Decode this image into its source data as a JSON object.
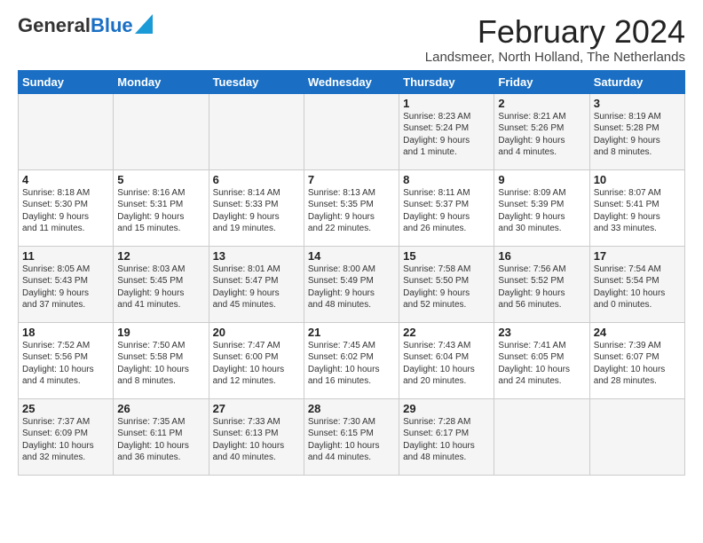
{
  "header": {
    "logo_general": "General",
    "logo_blue": "Blue",
    "month_title": "February 2024",
    "location": "Landsmeer, North Holland, The Netherlands"
  },
  "weekdays": [
    "Sunday",
    "Monday",
    "Tuesday",
    "Wednesday",
    "Thursday",
    "Friday",
    "Saturday"
  ],
  "rows": [
    [
      {
        "day": "",
        "info": ""
      },
      {
        "day": "",
        "info": ""
      },
      {
        "day": "",
        "info": ""
      },
      {
        "day": "",
        "info": ""
      },
      {
        "day": "1",
        "info": "Sunrise: 8:23 AM\nSunset: 5:24 PM\nDaylight: 9 hours\nand 1 minute."
      },
      {
        "day": "2",
        "info": "Sunrise: 8:21 AM\nSunset: 5:26 PM\nDaylight: 9 hours\nand 4 minutes."
      },
      {
        "day": "3",
        "info": "Sunrise: 8:19 AM\nSunset: 5:28 PM\nDaylight: 9 hours\nand 8 minutes."
      }
    ],
    [
      {
        "day": "4",
        "info": "Sunrise: 8:18 AM\nSunset: 5:30 PM\nDaylight: 9 hours\nand 11 minutes."
      },
      {
        "day": "5",
        "info": "Sunrise: 8:16 AM\nSunset: 5:31 PM\nDaylight: 9 hours\nand 15 minutes."
      },
      {
        "day": "6",
        "info": "Sunrise: 8:14 AM\nSunset: 5:33 PM\nDaylight: 9 hours\nand 19 minutes."
      },
      {
        "day": "7",
        "info": "Sunrise: 8:13 AM\nSunset: 5:35 PM\nDaylight: 9 hours\nand 22 minutes."
      },
      {
        "day": "8",
        "info": "Sunrise: 8:11 AM\nSunset: 5:37 PM\nDaylight: 9 hours\nand 26 minutes."
      },
      {
        "day": "9",
        "info": "Sunrise: 8:09 AM\nSunset: 5:39 PM\nDaylight: 9 hours\nand 30 minutes."
      },
      {
        "day": "10",
        "info": "Sunrise: 8:07 AM\nSunset: 5:41 PM\nDaylight: 9 hours\nand 33 minutes."
      }
    ],
    [
      {
        "day": "11",
        "info": "Sunrise: 8:05 AM\nSunset: 5:43 PM\nDaylight: 9 hours\nand 37 minutes."
      },
      {
        "day": "12",
        "info": "Sunrise: 8:03 AM\nSunset: 5:45 PM\nDaylight: 9 hours\nand 41 minutes."
      },
      {
        "day": "13",
        "info": "Sunrise: 8:01 AM\nSunset: 5:47 PM\nDaylight: 9 hours\nand 45 minutes."
      },
      {
        "day": "14",
        "info": "Sunrise: 8:00 AM\nSunset: 5:49 PM\nDaylight: 9 hours\nand 48 minutes."
      },
      {
        "day": "15",
        "info": "Sunrise: 7:58 AM\nSunset: 5:50 PM\nDaylight: 9 hours\nand 52 minutes."
      },
      {
        "day": "16",
        "info": "Sunrise: 7:56 AM\nSunset: 5:52 PM\nDaylight: 9 hours\nand 56 minutes."
      },
      {
        "day": "17",
        "info": "Sunrise: 7:54 AM\nSunset: 5:54 PM\nDaylight: 10 hours\nand 0 minutes."
      }
    ],
    [
      {
        "day": "18",
        "info": "Sunrise: 7:52 AM\nSunset: 5:56 PM\nDaylight: 10 hours\nand 4 minutes."
      },
      {
        "day": "19",
        "info": "Sunrise: 7:50 AM\nSunset: 5:58 PM\nDaylight: 10 hours\nand 8 minutes."
      },
      {
        "day": "20",
        "info": "Sunrise: 7:47 AM\nSunset: 6:00 PM\nDaylight: 10 hours\nand 12 minutes."
      },
      {
        "day": "21",
        "info": "Sunrise: 7:45 AM\nSunset: 6:02 PM\nDaylight: 10 hours\nand 16 minutes."
      },
      {
        "day": "22",
        "info": "Sunrise: 7:43 AM\nSunset: 6:04 PM\nDaylight: 10 hours\nand 20 minutes."
      },
      {
        "day": "23",
        "info": "Sunrise: 7:41 AM\nSunset: 6:05 PM\nDaylight: 10 hours\nand 24 minutes."
      },
      {
        "day": "24",
        "info": "Sunrise: 7:39 AM\nSunset: 6:07 PM\nDaylight: 10 hours\nand 28 minutes."
      }
    ],
    [
      {
        "day": "25",
        "info": "Sunrise: 7:37 AM\nSunset: 6:09 PM\nDaylight: 10 hours\nand 32 minutes."
      },
      {
        "day": "26",
        "info": "Sunrise: 7:35 AM\nSunset: 6:11 PM\nDaylight: 10 hours\nand 36 minutes."
      },
      {
        "day": "27",
        "info": "Sunrise: 7:33 AM\nSunset: 6:13 PM\nDaylight: 10 hours\nand 40 minutes."
      },
      {
        "day": "28",
        "info": "Sunrise: 7:30 AM\nSunset: 6:15 PM\nDaylight: 10 hours\nand 44 minutes."
      },
      {
        "day": "29",
        "info": "Sunrise: 7:28 AM\nSunset: 6:17 PM\nDaylight: 10 hours\nand 48 minutes."
      },
      {
        "day": "",
        "info": ""
      },
      {
        "day": "",
        "info": ""
      }
    ]
  ]
}
